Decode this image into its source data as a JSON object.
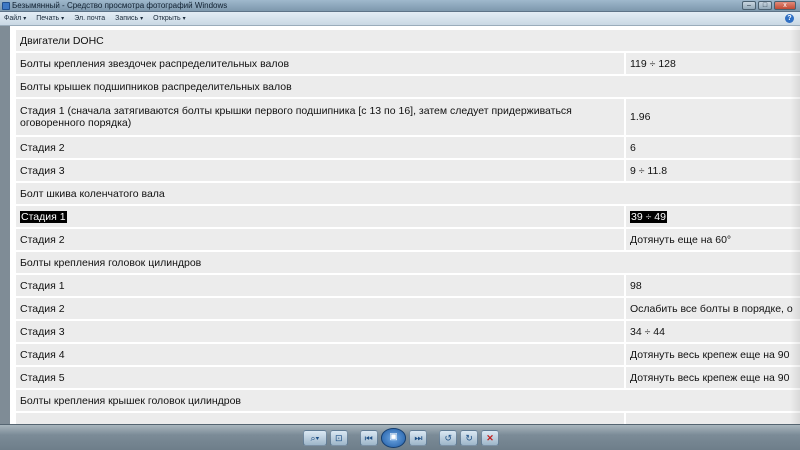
{
  "window": {
    "title": "Безымянный - Средство просмотра фотографий Windows",
    "controls": {
      "minimize": "–",
      "maximize": "□",
      "close": "x"
    }
  },
  "menu": {
    "items": [
      {
        "label": "Файл"
      },
      {
        "label": "Печать"
      },
      {
        "label": "Эл. почта"
      },
      {
        "label": "Запись"
      },
      {
        "label": "Открыть"
      }
    ],
    "caret": "▾",
    "help": "?"
  },
  "table": {
    "rows": [
      {
        "label": "Двигатели DOHC",
        "value": ""
      },
      {
        "label": "Болты крепления звездочек распределительных валов",
        "value": "119 ÷ 128"
      },
      {
        "label": "Болты крышек подшипников распределительных валов",
        "value": ""
      },
      {
        "label": "Стадия 1 (сначала затягиваются болты крышки первого подшипника [с 13 по 16], затем следует придерживаться оговоренного порядка)",
        "value": "1.96"
      },
      {
        "label": "Стадия 2",
        "value": "6"
      },
      {
        "label": "Стадия 3",
        "value": "9 ÷ 11.8"
      },
      {
        "label": "Болт шкива коленчатого вала",
        "value": ""
      },
      {
        "label": "Стадия 1",
        "value": "39 ÷ 49"
      },
      {
        "label": "Стадия 2",
        "value": "Дотянуть еще на 60°"
      },
      {
        "label": "Болты крепления головок цилиндров",
        "value": ""
      },
      {
        "label": "Стадия 1",
        "value": "98"
      },
      {
        "label": "Стадия 2",
        "value": "Ослабить все болты в порядке, о"
      },
      {
        "label": "Стадия 3",
        "value": "34 ÷ 44"
      },
      {
        "label": "Стадия 4",
        "value": "Дотянуть весь крепеж еще на 90"
      },
      {
        "label": "Стадия 5",
        "value": "Дотянуть весь крепеж еще на 90"
      },
      {
        "label": "Болты крепления крышек головок цилиндров",
        "value": ""
      },
      {
        "label": "",
        "value": ""
      }
    ]
  },
  "toolbar": {
    "zoom": "⌕▾",
    "fit": "⊡",
    "prev": "⏮",
    "slideshow": "▣",
    "next": "⏭",
    "rotate_ccw": "↺",
    "rotate_cw": "↻",
    "delete": "✕"
  }
}
